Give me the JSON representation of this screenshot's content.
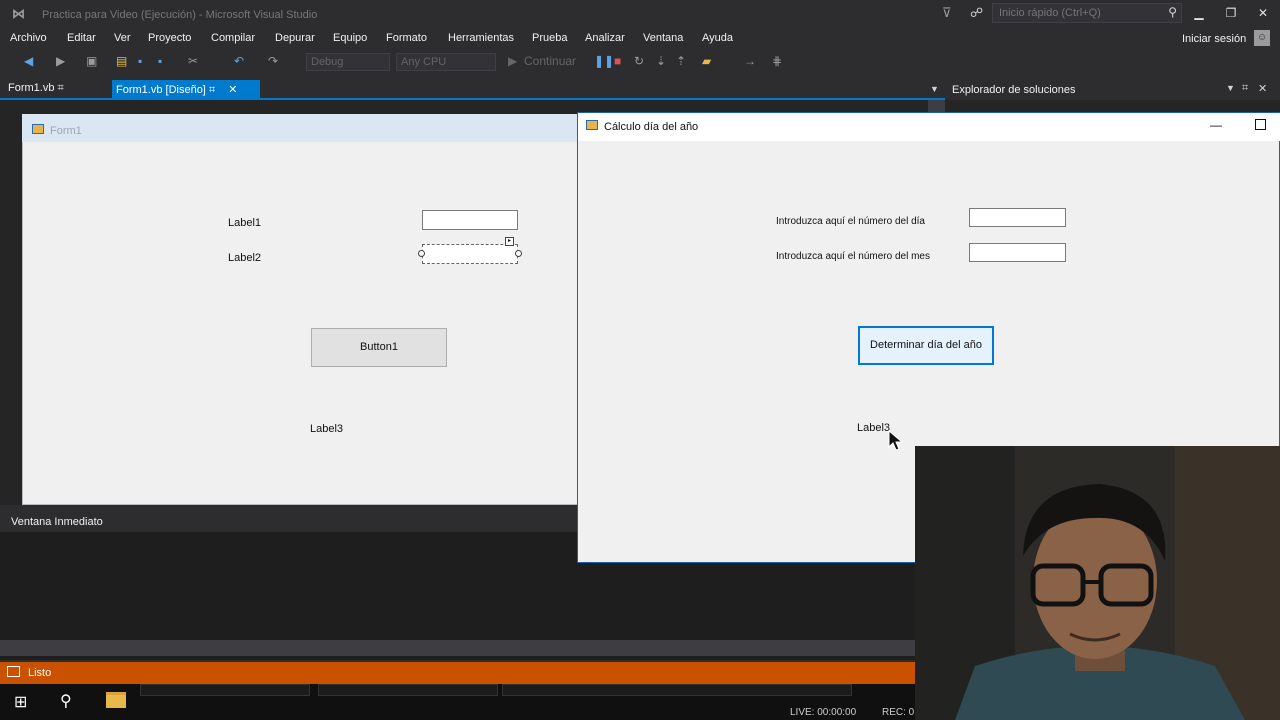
{
  "window": {
    "title": "Practica para Video (Ejecución) - Microsoft Visual Studio",
    "quick_launch_placeholder": "Inicio rápido (Ctrl+Q)",
    "sign_in": "Iniciar sesión"
  },
  "menu": [
    "Archivo",
    "Editar",
    "Ver",
    "Proyecto",
    "Compilar",
    "Depurar",
    "Equipo",
    "Formato",
    "Herramientas",
    "Prueba",
    "Analizar",
    "Ventana",
    "Ayuda"
  ],
  "toolbar": {
    "config": "Debug",
    "platform": "Any CPU",
    "continue_label": "Continuar"
  },
  "tabs": [
    {
      "label": "Form1.vb",
      "pin": "⌗"
    },
    {
      "label": "Form1.vb [Diseño]",
      "pin": "⌗",
      "close": "✕"
    }
  ],
  "designer": {
    "form_title": "Form1",
    "label1": "Label1",
    "label2": "Label2",
    "button1": "Button1",
    "label3": "Label3"
  },
  "immediate": {
    "title": "Ventana Inmediato"
  },
  "solution_explorer": {
    "title": "Explorador de soluciones"
  },
  "status": {
    "text": "Listo"
  },
  "taskbar": {
    "live": "LIVE: 00:00:00",
    "rec": "REC: 0"
  },
  "app": {
    "title": "Cálculo día del año",
    "label_day": "Introduzca aquí el número del día",
    "label_month": "Introduzca aquí el número del mes",
    "button": "Determinar día del año",
    "label3": "Label3",
    "day_value": "",
    "month_value": ""
  },
  "colors": {
    "accent": "#007acc",
    "status_bar": "#ca5100",
    "ide_background": "#2d2d30"
  }
}
